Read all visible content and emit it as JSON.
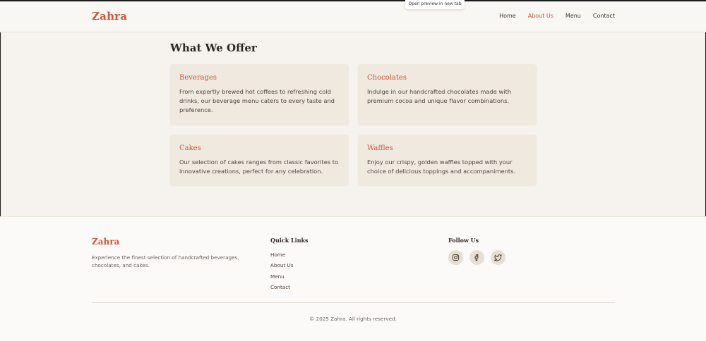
{
  "tooltip": "Open preview in new tab",
  "header": {
    "logo": "Zahra",
    "nav": [
      "Home",
      "About Us",
      "Menu",
      "Contact"
    ],
    "active_nav": "About Us"
  },
  "offer": {
    "title": "What We Offer",
    "cards": [
      {
        "title": "Beverages",
        "text": "From expertly brewed hot coffees to refreshing cold drinks, our beverage menu caters to every taste and preference."
      },
      {
        "title": "Chocolates",
        "text": "Indulge in our handcrafted chocolates made with premium cocoa and unique flavor combinations."
      },
      {
        "title": "Cakes",
        "text": "Our selection of cakes ranges from classic favorites to innovative creations, perfect for any celebration."
      },
      {
        "title": "Waffles",
        "text": "Enjoy our crispy, golden waffles topped with your choice of delicious toppings and accompaniments."
      }
    ]
  },
  "footer": {
    "brand": "Zahra",
    "description": "Experience the finest selection of handcrafted beverages, chocolates, and cakes.",
    "quick_links_title": "Quick Links",
    "quick_links": [
      "Home",
      "About Us",
      "Menu",
      "Contact"
    ],
    "follow_title": "Follow Us",
    "socials": [
      "instagram-icon",
      "facebook-icon",
      "twitter-icon"
    ],
    "copyright": "© 2025 Zahra. All rights reserved."
  },
  "colors": {
    "accent": "#c9573c",
    "background": "#f6f3ee",
    "card": "#f0e9e0"
  }
}
